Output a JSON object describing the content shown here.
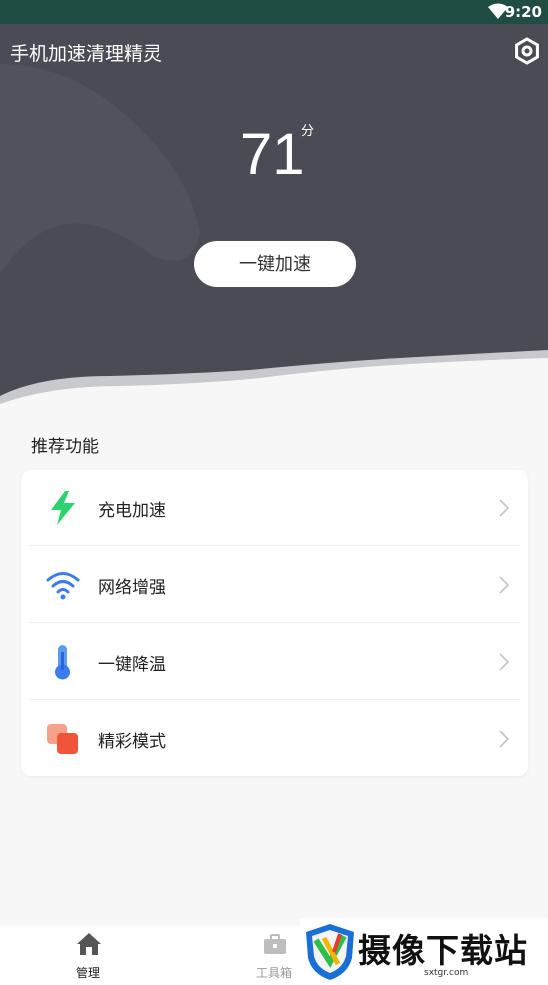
{
  "status_bar": {
    "time": "9:20"
  },
  "header": {
    "title": "手机加速清理精灵"
  },
  "score": {
    "value": "71",
    "unit": "分"
  },
  "boost_button": {
    "label": "一键加速"
  },
  "recommended": {
    "title": "推荐功能",
    "items": [
      {
        "label": "充电加速",
        "icon": "lightning-icon",
        "color": "#2dd36f"
      },
      {
        "label": "网络增强",
        "icon": "wifi-icon",
        "color": "#3c7cf0"
      },
      {
        "label": "一键降温",
        "icon": "thermometer-icon",
        "color": "#3c7cf0"
      },
      {
        "label": "精彩模式",
        "icon": "layers-icon",
        "color": "#f0553a"
      }
    ]
  },
  "tabbar": {
    "tabs": [
      {
        "label": "管理",
        "icon": "home-icon",
        "active": true
      },
      {
        "label": "工具箱",
        "icon": "toolbox-icon",
        "active": false
      }
    ]
  },
  "watermark": {
    "text": "摄像下载站",
    "url": "sxtgr.com"
  },
  "colors": {
    "status_bar": "#1f4c43",
    "hero": "#4b4b55",
    "background": "#f7f7f7"
  }
}
